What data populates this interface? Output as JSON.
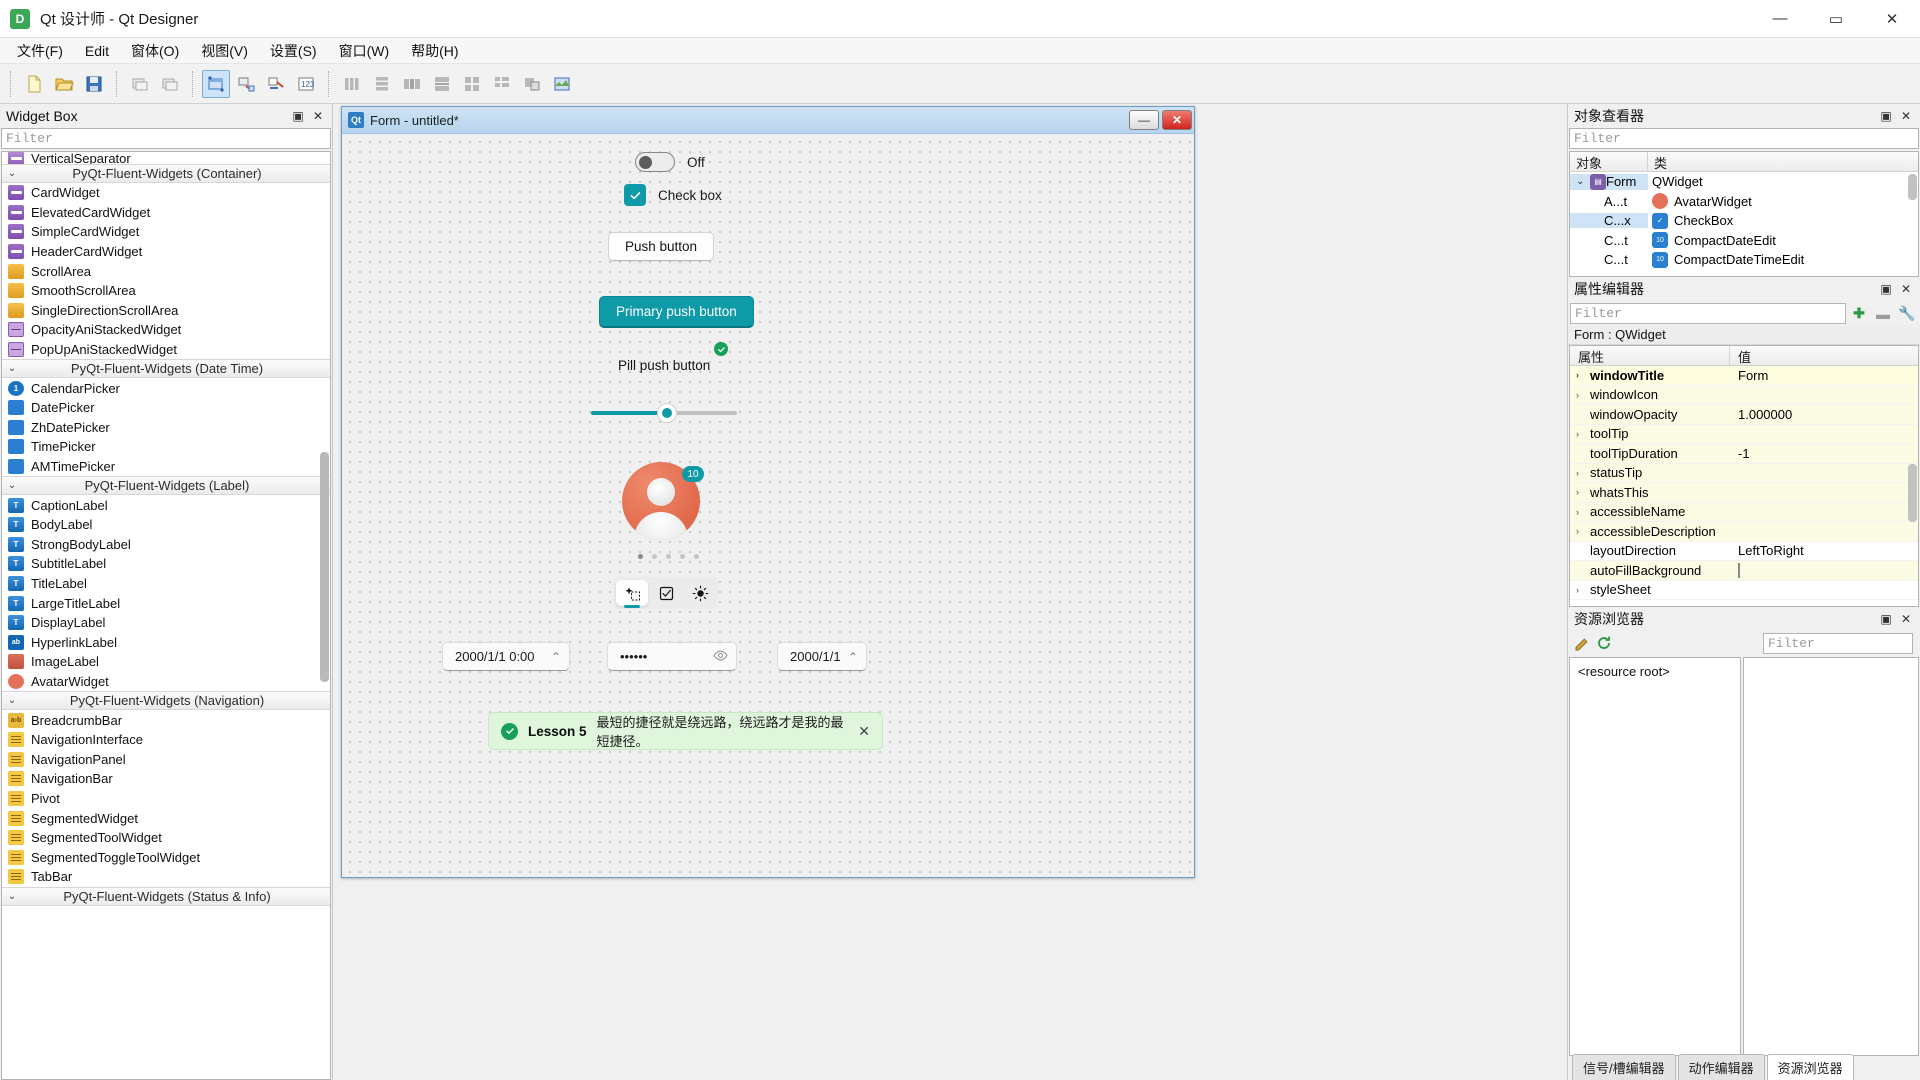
{
  "titlebar": {
    "icon": "qt-designer-icon",
    "title": "Qt 设计师 - Qt Designer",
    "minimize": "—",
    "maximize": "▭",
    "close": "✕"
  },
  "menubar": {
    "items": [
      {
        "label": "文件(F)"
      },
      {
        "label": "Edit"
      },
      {
        "label": "窗体(O)"
      },
      {
        "label": "视图(V)"
      },
      {
        "label": "设置(S)"
      },
      {
        "label": "窗口(W)"
      },
      {
        "label": "帮助(H)"
      }
    ]
  },
  "toolbar": {
    "groups": [
      [
        "new-file",
        "open-file",
        "save-file"
      ],
      [
        "undo",
        "redo"
      ],
      [
        "edit-widgets",
        "edit-signals-slots",
        "edit-buddies",
        "edit-tab-order"
      ],
      [
        "layout-horizontal",
        "layout-vertical",
        "layout-splitter-h",
        "layout-splitter-v",
        "layout-grid",
        "layout-form",
        "layout-break",
        "layout-adjust-size"
      ]
    ]
  },
  "widget_box": {
    "title": "Widget Box",
    "filter_placeholder": "Filter",
    "float_btn": "▣",
    "close_btn": "✕",
    "partial_top_item": "VerticalSeparator",
    "groups": [
      {
        "name": "PyQt-Fluent-Widgets (Container)",
        "collapsed": false,
        "items": [
          {
            "label": "CardWidget",
            "icon": "card-icon"
          },
          {
            "label": "ElevatedCardWidget",
            "icon": "card-icon"
          },
          {
            "label": "SimpleCardWidget",
            "icon": "card-icon"
          },
          {
            "label": "HeaderCardWidget",
            "icon": "card-icon"
          },
          {
            "label": "ScrollArea",
            "icon": "scroll-icon"
          },
          {
            "label": "SmoothScrollArea",
            "icon": "scroll-icon"
          },
          {
            "label": "SingleDirectionScrollArea",
            "icon": "scroll-icon"
          },
          {
            "label": "OpacityAniStackedWidget",
            "icon": "stack-icon"
          },
          {
            "label": "PopUpAniStackedWidget",
            "icon": "stack-icon"
          }
        ]
      },
      {
        "name": "PyQt-Fluent-Widgets (Date Time)",
        "collapsed": false,
        "items": [
          {
            "label": "CalendarPicker",
            "icon": "calendar-icon"
          },
          {
            "label": "DatePicker",
            "icon": "date-icon"
          },
          {
            "label": "ZhDatePicker",
            "icon": "date-icon"
          },
          {
            "label": "TimePicker",
            "icon": "time-icon"
          },
          {
            "label": "AMTimePicker",
            "icon": "time-icon"
          }
        ]
      },
      {
        "name": "PyQt-Fluent-Widgets (Label)",
        "collapsed": false,
        "items": [
          {
            "label": "CaptionLabel",
            "icon": "text-icon"
          },
          {
            "label": "BodyLabel",
            "icon": "text-icon"
          },
          {
            "label": "StrongBodyLabel",
            "icon": "text-icon"
          },
          {
            "label": "SubtitleLabel",
            "icon": "text-icon"
          },
          {
            "label": "TitleLabel",
            "icon": "text-icon"
          },
          {
            "label": "LargeTitleLabel",
            "icon": "text-icon"
          },
          {
            "label": "DisplayLabel",
            "icon": "text-icon"
          },
          {
            "label": "HyperlinkLabel",
            "icon": "hyperlink-icon"
          },
          {
            "label": "ImageLabel",
            "icon": "image-icon"
          },
          {
            "label": "AvatarWidget",
            "icon": "avatar-icon"
          }
        ]
      },
      {
        "name": "PyQt-Fluent-Widgets (Navigation)",
        "collapsed": false,
        "items": [
          {
            "label": "BreadcrumbBar",
            "icon": "breadcrumb-icon"
          },
          {
            "label": "NavigationInterface",
            "icon": "navigation-icon"
          },
          {
            "label": "NavigationPanel",
            "icon": "navigation-icon"
          },
          {
            "label": "NavigationBar",
            "icon": "navigation-icon"
          },
          {
            "label": "Pivot",
            "icon": "navigation-icon"
          },
          {
            "label": "SegmentedWidget",
            "icon": "navigation-icon"
          },
          {
            "label": "SegmentedToolWidget",
            "icon": "navigation-icon"
          },
          {
            "label": "SegmentedToggleToolWidget",
            "icon": "navigation-icon"
          },
          {
            "label": "TabBar",
            "icon": "navigation-icon"
          }
        ]
      },
      {
        "name": "PyQt-Fluent-Widgets (Status & Info)",
        "collapsed": false,
        "items": []
      }
    ]
  },
  "form_window": {
    "icon": "qt-form-icon",
    "title": "Form - untitled*",
    "minimize": "—",
    "close": "✕",
    "widgets": {
      "switch_label": "Off",
      "checkbox_label": "Check box",
      "push_button": "Push button",
      "primary_push_button": "Primary push button",
      "pill_push_button": "Pill push button",
      "slider_value_percent": 45,
      "avatar_badge": "10",
      "pager_dots": 5,
      "pager_active_index": 0,
      "segmented_icons": [
        "sparkle-select-icon",
        "checkbox-icon",
        "brightness-icon"
      ],
      "segmented_selected_index": 0,
      "datetime_edit_value": "2000/1/1 0:00",
      "password_value": "••••••",
      "password_reveal_icon": "eye-icon",
      "date_edit_value": "2000/1/1",
      "infobar": {
        "icon": "success-icon",
        "title": "Lesson 5",
        "text": "最短的捷径就是绕远路，绕远路才是我的最短捷径。",
        "close": "✕"
      }
    }
  },
  "object_inspector": {
    "title": "对象查看器",
    "float_btn": "▣",
    "close_btn": "✕",
    "filter_placeholder": "Filter",
    "columns": [
      "对象",
      "类"
    ],
    "rows": [
      {
        "object": "Form",
        "class": "QWidget",
        "icon": "form-icon",
        "depth": 0,
        "expanded": true,
        "selected": true
      },
      {
        "object": "A...t",
        "class": "AvatarWidget",
        "icon": "avatar-icon",
        "depth": 1,
        "selected": false
      },
      {
        "object": "C...x",
        "class": "CheckBox",
        "icon": "checkbox-icon",
        "depth": 1,
        "selected": true
      },
      {
        "object": "C...t",
        "class": "CompactDateEdit",
        "icon": "date-icon",
        "depth": 1,
        "selected": false
      },
      {
        "object": "C...t",
        "class": "CompactDateTimeEdit",
        "icon": "date-icon",
        "depth": 1,
        "selected": false
      }
    ]
  },
  "property_editor": {
    "title": "属性编辑器",
    "float_btn": "▣",
    "close_btn": "✕",
    "filter_placeholder": "Filter",
    "add_icon": "plus-icon",
    "remove_icon": "minus-icon",
    "configure_icon": "wrench-icon",
    "object_line": "Form : QWidget",
    "columns": [
      "属性",
      "值"
    ],
    "rows": [
      {
        "key": "windowTitle",
        "value": "Form",
        "bold": true,
        "expandable": true,
        "highlight": "strong"
      },
      {
        "key": "windowIcon",
        "value": "",
        "expandable": true,
        "highlight": "light"
      },
      {
        "key": "windowOpacity",
        "value": "1.000000",
        "expandable": false,
        "highlight": "light"
      },
      {
        "key": "toolTip",
        "value": "",
        "expandable": true,
        "highlight": "light"
      },
      {
        "key": "toolTipDuration",
        "value": "-1",
        "expandable": false,
        "highlight": "light"
      },
      {
        "key": "statusTip",
        "value": "",
        "expandable": true,
        "highlight": "light"
      },
      {
        "key": "whatsThis",
        "value": "",
        "expandable": true,
        "highlight": "light"
      },
      {
        "key": "accessibleName",
        "value": "",
        "expandable": true,
        "highlight": "light"
      },
      {
        "key": "accessibleDescription",
        "value": "",
        "expandable": true,
        "highlight": "light"
      },
      {
        "key": "layoutDirection",
        "value": "LeftToRight",
        "expandable": false,
        "highlight": "none"
      },
      {
        "key": "autoFillBackground",
        "value": "",
        "checkbox": true,
        "expandable": false,
        "highlight": "light"
      },
      {
        "key": "styleSheet",
        "value": "",
        "expandable": true,
        "highlight": "none"
      }
    ]
  },
  "resource_browser": {
    "title": "资源浏览器",
    "float_btn": "▣",
    "close_btn": "✕",
    "edit_icon": "pencil-icon",
    "reload_icon": "reload-icon",
    "filter_placeholder": "Filter",
    "tree_root": "<resource root>"
  },
  "bottom_tabs": {
    "items": [
      {
        "label": "信号/槽编辑器",
        "active": false
      },
      {
        "label": "动作编辑器",
        "active": false
      },
      {
        "label": "资源浏览器",
        "active": true
      }
    ]
  },
  "colors": {
    "accent_teal": "#0e9aa7",
    "success_green": "#18a058",
    "avatar_orange": "#e2684a",
    "selection_blue": "#cfe3f7",
    "infobar_bg": "#dff6dd"
  }
}
